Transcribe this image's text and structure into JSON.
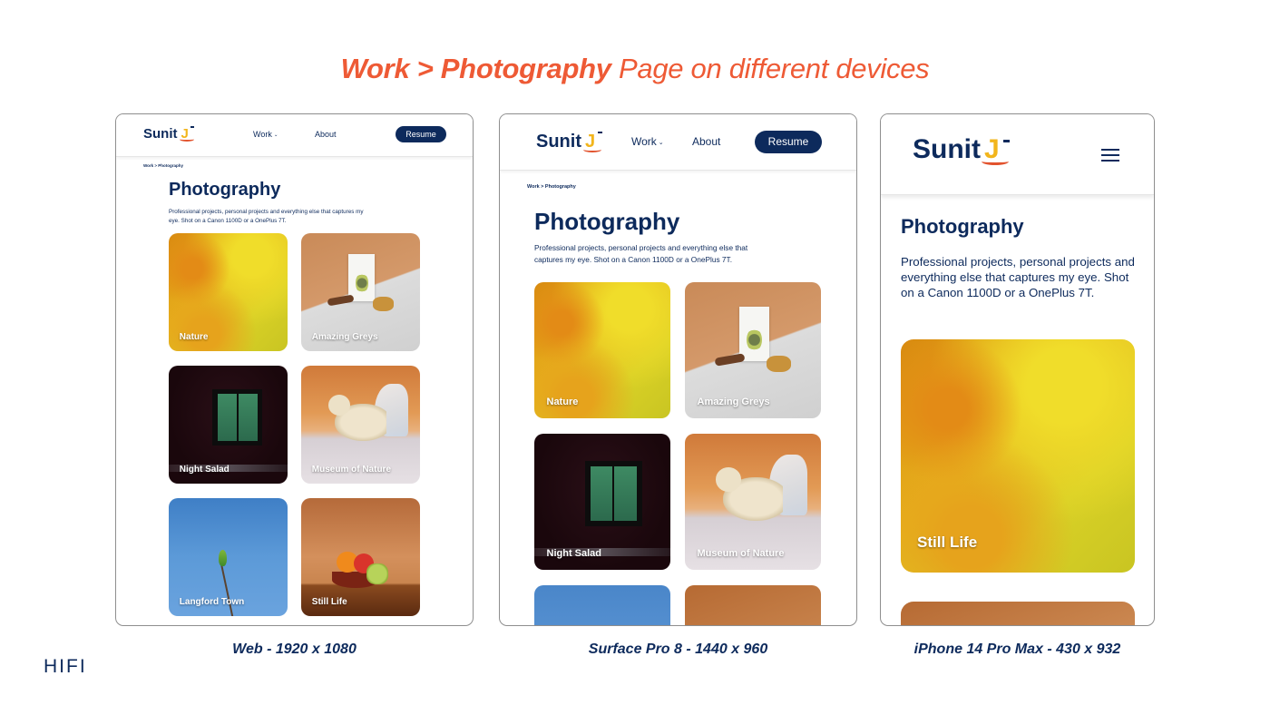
{
  "main_title": {
    "bold": "Work > Photography",
    "regular": "Page on different devices"
  },
  "site": {
    "logo": {
      "text": "Sunit",
      "mark": "J"
    },
    "nav": {
      "work": "Work",
      "about": "About",
      "resume": "Resume"
    },
    "breadcrumb": "Work > Photography",
    "page_title": "Photography",
    "description": "Professional projects, personal projects and everything else that captures my eye. Shot on a Canon 1100D or a OnePlus 7T."
  },
  "web": {
    "caption": "Web - 1920 x 1080",
    "cards": [
      {
        "label": "Nature",
        "image": "yellow-flower-macro"
      },
      {
        "label": "Amazing Greys",
        "image": "product-box-still"
      },
      {
        "label": "Night Salad",
        "image": "lit-window-at-night"
      },
      {
        "label": "Museum of Nature",
        "image": "polar-bear-diorama"
      },
      {
        "label": "Langford Town",
        "image": "parakeet-on-branch-blue-sky"
      },
      {
        "label": "Still Life",
        "image": "fruit-bowl"
      }
    ]
  },
  "surface": {
    "caption": "Surface Pro 8 - 1440 x 960",
    "cards": [
      {
        "label": "Nature",
        "image": "yellow-flower-macro"
      },
      {
        "label": "Amazing Greys",
        "image": "product-box-still"
      },
      {
        "label": "Night Salad",
        "image": "lit-window-at-night"
      },
      {
        "label": "Museum of Nature",
        "image": "polar-bear-diorama"
      }
    ]
  },
  "phone": {
    "caption": "iPhone 14 Pro Max - 430 x 932",
    "menu_icon": "hamburger-menu-icon",
    "cards": [
      {
        "label": "Still Life",
        "image": "yellow-flower-macro"
      }
    ]
  },
  "footer_label": "HIFI",
  "colors": {
    "accent": "#ee5a35",
    "navy": "#0d2a5c",
    "logo_yellow": "#f2b51c",
    "logo_red": "#e2532e"
  }
}
